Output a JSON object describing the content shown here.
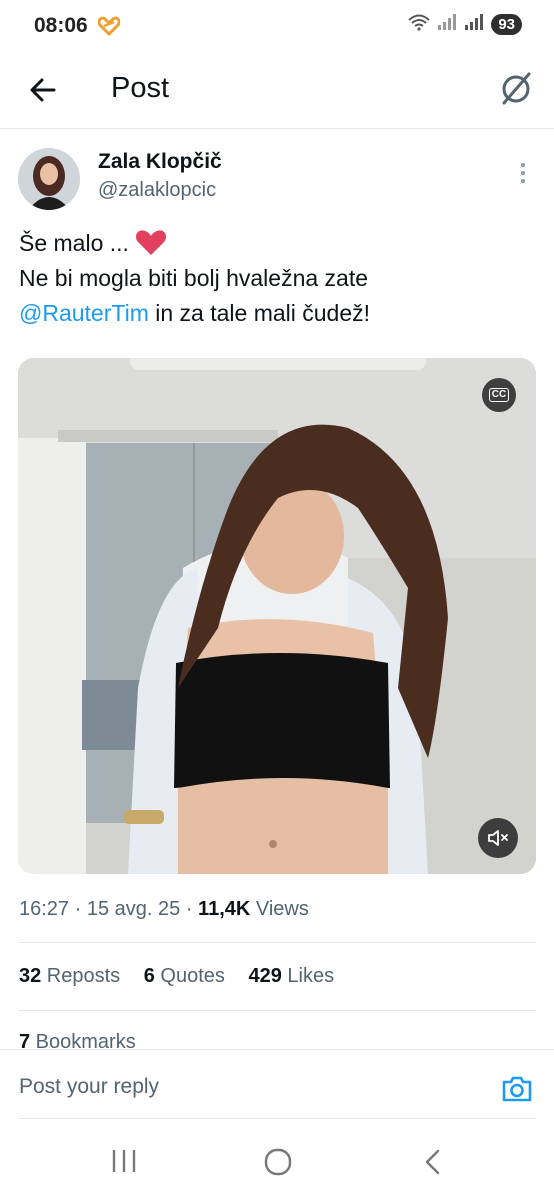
{
  "status_bar": {
    "time": "08:06",
    "battery": "93"
  },
  "header": {
    "title": "Post"
  },
  "author": {
    "name": "Zala Klopčič",
    "handle": "@zalaklopcic"
  },
  "post": {
    "line1": "Še malo ... ",
    "emoji": "❤️",
    "line2": "Ne bi mogla biti bolj hvaležna zate",
    "mention": "@RauterTim",
    "line3_rest": " in za tale mali čudež!"
  },
  "media": {
    "cc_label": "CC"
  },
  "meta": {
    "time": "16:27",
    "sep1": " · ",
    "date": "15 avg. 25",
    "sep2": " · ",
    "views_count": "11,4K",
    "views_label": " Views"
  },
  "stats": {
    "reposts_count": "32",
    "reposts_label": " Reposts",
    "quotes_count": "6",
    "quotes_label": " Quotes",
    "likes_count": "429",
    "likes_label": " Likes",
    "bookmarks_count": "7",
    "bookmarks_label": " Bookmarks"
  },
  "reply": {
    "placeholder": "Post your reply"
  },
  "colors": {
    "accent": "#1d9bf0",
    "text": "#0f1419",
    "secondary": "#536471"
  }
}
